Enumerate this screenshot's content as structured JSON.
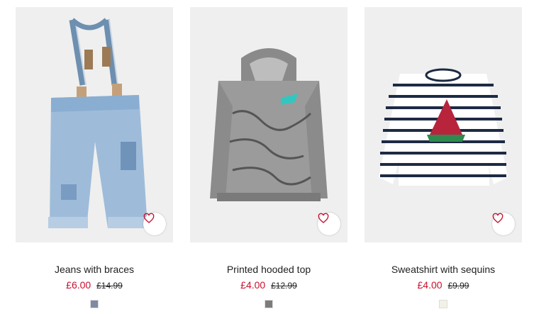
{
  "products": [
    {
      "name": "Jeans with braces",
      "price": "£6.00",
      "old_price": "£14.99",
      "swatch_color": "#7f8aa3",
      "image_label": "product-image-jeans-with-braces"
    },
    {
      "name": "Printed hooded top",
      "price": "£4.00",
      "old_price": "£12.99",
      "swatch_color": "#7c7c7c",
      "image_label": "product-image-printed-hooded-top"
    },
    {
      "name": "Sweatshirt with sequins",
      "price": "£4.00",
      "old_price": "£9.99",
      "swatch_color": "#f3f1e6",
      "image_label": "product-image-sweatshirt-with-sequins"
    }
  ],
  "icons": {
    "favourite": "heart-icon"
  },
  "colors": {
    "sale_price": "#c8102e",
    "image_bg": "#efefef"
  }
}
